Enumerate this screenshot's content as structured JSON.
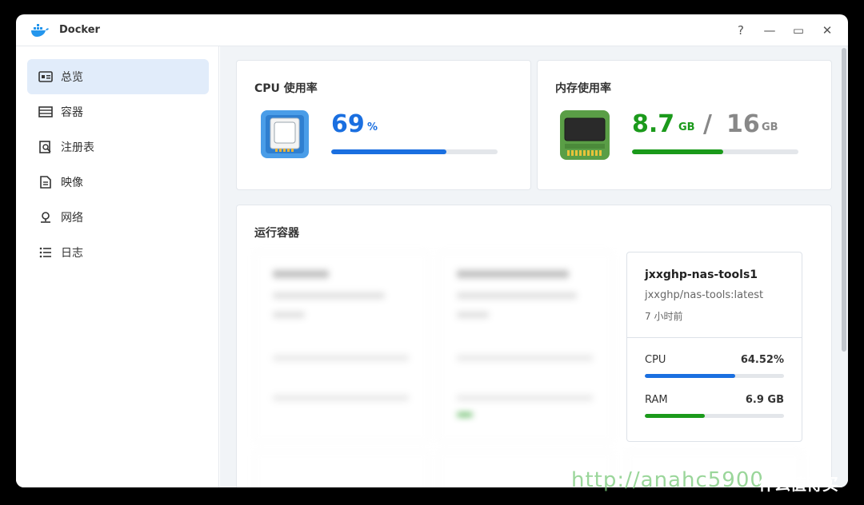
{
  "window": {
    "title": "Docker"
  },
  "controls": {
    "help": "?",
    "minimize": "—",
    "maximize": "▭",
    "close": "✕"
  },
  "sidebar": {
    "items": [
      {
        "label": "总览",
        "icon": "overview-icon"
      },
      {
        "label": "容器",
        "icon": "container-icon"
      },
      {
        "label": "注册表",
        "icon": "registry-icon"
      },
      {
        "label": "映像",
        "icon": "image-icon"
      },
      {
        "label": "网络",
        "icon": "network-icon"
      },
      {
        "label": "日志",
        "icon": "log-icon"
      }
    ]
  },
  "cpu": {
    "title": "CPU 使用率",
    "value": "69",
    "unit": "%",
    "progress": 0.69,
    "color": "#1a6fe0"
  },
  "memory": {
    "title": "内存使用率",
    "used": "8.7",
    "used_unit": "GB",
    "sep": "/",
    "total": "16",
    "total_unit": "GB",
    "progress": 0.55,
    "color": "#1b9a1b"
  },
  "running": {
    "title": "运行容器"
  },
  "container": {
    "name": "jxxghp-nas-tools1",
    "image": "jxxghp/nas-tools:latest",
    "time": "7 小时前",
    "cpu_label": "CPU",
    "cpu_value": "64.52%",
    "cpu_progress": 0.65,
    "ram_label": "RAM",
    "ram_value": "6.9 GB",
    "ram_progress": 0.43
  },
  "watermark": {
    "url": "http://anahc5900",
    "site": "什么值得买"
  }
}
